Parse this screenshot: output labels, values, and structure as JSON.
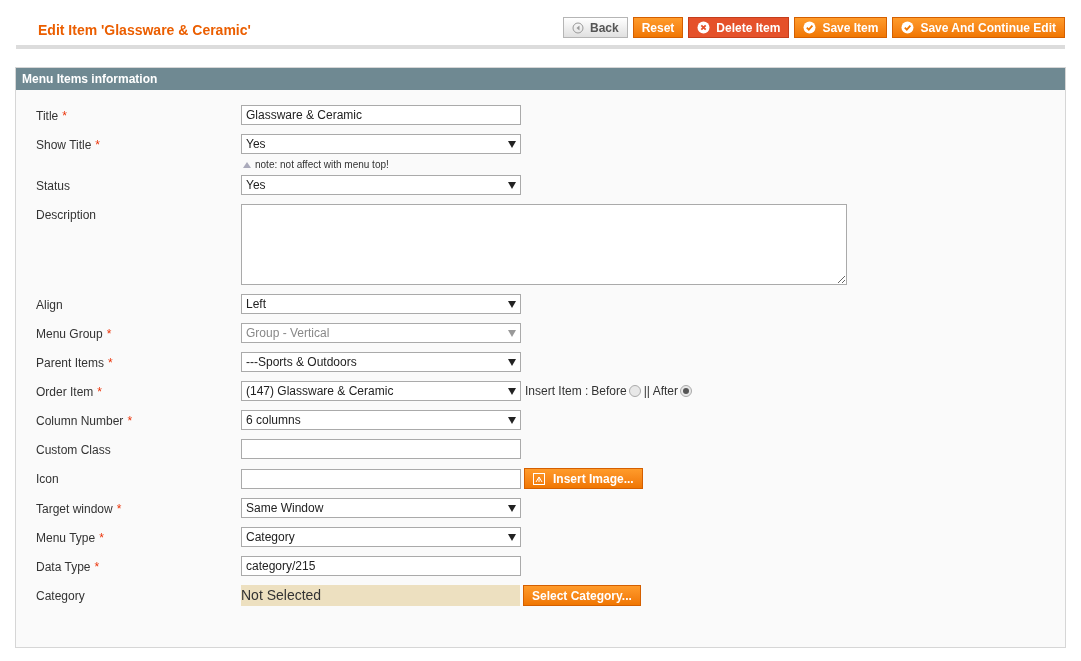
{
  "page_title": "Edit Item 'Glassware & Ceramic'",
  "buttons": [
    {
      "label": "Back",
      "kind": "back"
    },
    {
      "label": "Reset",
      "kind": "plain"
    },
    {
      "label": "Delete Item",
      "kind": "delete"
    },
    {
      "label": "Save Item",
      "kind": "save"
    },
    {
      "label": "Save And Continue Edit",
      "kind": "save"
    }
  ],
  "section": {
    "title": "Menu Items information",
    "fields": [
      {
        "label": "Title",
        "required_mark": "*",
        "kind": "text",
        "value": "Glassware & Ceramic"
      },
      {
        "label": "Show Title",
        "required_mark": "*",
        "kind": "select",
        "value": "Yes",
        "disabled": false,
        "note": "note: not affect with menu top!"
      },
      {
        "label": "Status",
        "kind": "select",
        "value": "Yes",
        "disabled": false
      },
      {
        "label": "Description",
        "kind": "textarea"
      },
      {
        "label": "Align",
        "kind": "select",
        "value": "Left",
        "disabled": false
      },
      {
        "label": "Menu Group",
        "required_mark": "*",
        "kind": "select",
        "value": "Group - Vertical",
        "disabled": true
      },
      {
        "label": "Parent Items",
        "required_mark": "*",
        "kind": "select",
        "value": "---Sports & Outdoors",
        "disabled": false
      },
      {
        "label": "Order Item",
        "required_mark": "*",
        "kind": "select",
        "value": "(147) Glassware & Ceramic",
        "disabled": false,
        "radio_prefix": "Insert Item :",
        "radios": [
          {
            "label": "Before",
            "selected": false
          },
          {
            "label": "|| After",
            "selected": true
          }
        ]
      },
      {
        "label": "Column Number",
        "required_mark": "*",
        "kind": "select",
        "value": "6 columns",
        "disabled": false
      },
      {
        "label": "Custom Class",
        "kind": "text"
      },
      {
        "label": "Icon",
        "kind": "text",
        "button": "Insert Image..."
      },
      {
        "label": "Target window",
        "required_mark": "*",
        "kind": "select",
        "value": "Same Window",
        "disabled": false
      },
      {
        "label": "Menu Type",
        "required_mark": "*",
        "kind": "select",
        "value": "Category",
        "disabled": false
      },
      {
        "label": "Data Type",
        "required_mark": "*",
        "kind": "text",
        "value": "category/215"
      },
      {
        "label": "Category",
        "kind": "chooser",
        "value": "Not Selected",
        "button": "Select Category..."
      }
    ]
  }
}
